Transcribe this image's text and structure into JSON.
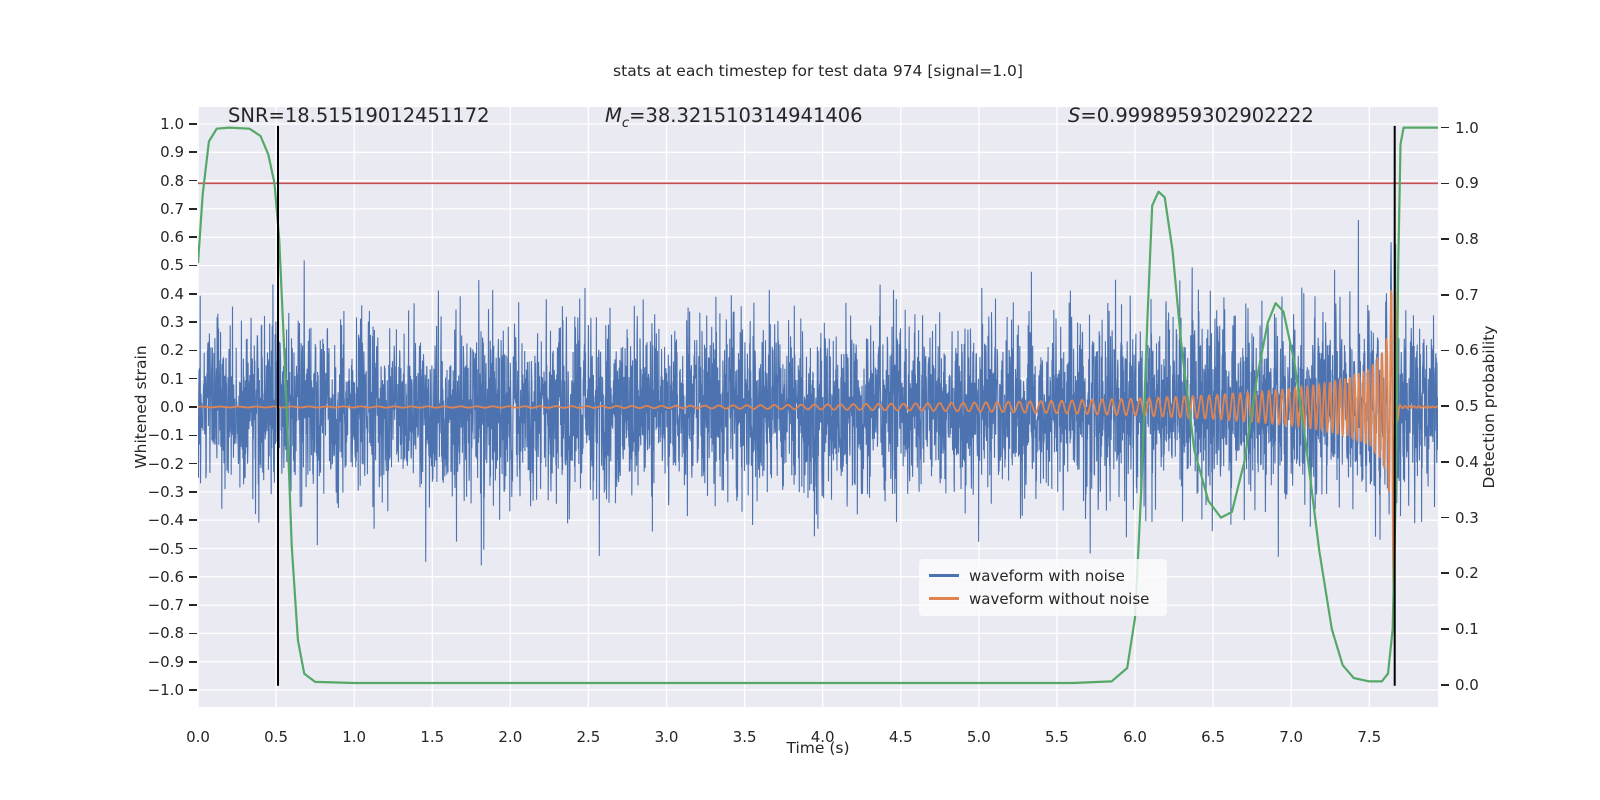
{
  "title": "stats at each timestep for test data 974 [signal=1.0]",
  "annotations": {
    "snr": "SNR=18.51519012451172",
    "mc_symbol": "M",
    "mc_sub": "c",
    "mc_value": "=38.321510314941406",
    "s_symbol": "S",
    "s_value": "=0.9998959302902222"
  },
  "axis_labels": {
    "y_left": "Whitened strain",
    "y_right": "Detection probability",
    "x": "Time (s)"
  },
  "legend": {
    "position": "lower right",
    "items": [
      {
        "label": "waveform with noise",
        "color": "#4C72B0"
      },
      {
        "label": "waveform without noise",
        "color": "#DD8452"
      }
    ]
  },
  "colors": {
    "axes_background": "#EAEAF2",
    "grid": "#FFFFFF",
    "text": "#262626",
    "noise_waveform": "#4C72B0",
    "clean_waveform": "#DD8452",
    "detection_probability": "#55A868",
    "threshold_line": "#C44E52",
    "marker_line": "#000000"
  },
  "chart_data": {
    "type": "line",
    "title": "stats at each timestep for test data 974 [signal=1.0]",
    "grid": true,
    "x_axis": {
      "label": "Time (s)",
      "range": [
        0,
        7.94
      ],
      "tick_labels": [
        "0.0",
        "0.5",
        "1.0",
        "1.5",
        "2.0",
        "2.5",
        "3.0",
        "3.5",
        "4.0",
        "4.5",
        "5.0",
        "5.5",
        "6.0",
        "6.5",
        "7.0",
        "7.5"
      ],
      "tick_values": [
        0,
        0.5,
        1,
        1.5,
        2,
        2.5,
        3,
        3.5,
        4,
        4.5,
        5,
        5.5,
        6,
        6.5,
        7,
        7.5
      ]
    },
    "y_left_axis": {
      "label": "Whitened strain",
      "range": [
        -1.06,
        1.06
      ],
      "tick_labels": [
        "1.0",
        "0.9",
        "0.8",
        "0.7",
        "0.6",
        "0.5",
        "0.4",
        "0.3",
        "0.2",
        "0.1",
        "0.0",
        "−0.1",
        "−0.2",
        "−0.3",
        "−0.4",
        "−0.5",
        "−0.6",
        "−0.7",
        "−0.8",
        "−0.9",
        "−1.0"
      ],
      "tick_values": [
        1,
        0.9,
        0.8,
        0.7,
        0.6,
        0.5,
        0.4,
        0.3,
        0.2,
        0.1,
        0,
        -0.1,
        -0.2,
        -0.3,
        -0.4,
        -0.5,
        -0.6,
        -0.7,
        -0.8,
        -0.9,
        -1
      ]
    },
    "y_right_axis": {
      "label": "Detection probability",
      "range": [
        -0.04,
        1.037
      ],
      "tick_labels": [
        "0.0",
        "0.1",
        "0.2",
        "0.3",
        "0.4",
        "0.5",
        "0.6",
        "0.7",
        "0.8",
        "0.9",
        "1.0"
      ],
      "tick_values": [
        0,
        0.1,
        0.2,
        0.3,
        0.4,
        0.5,
        0.6,
        0.7,
        0.8,
        0.9,
        1
      ]
    },
    "series": [
      {
        "name": "waveform with noise",
        "color": "#4C72B0",
        "axis": "left",
        "style": "gaussian_noise_plus_signal",
        "noise_sigma": 0.155,
        "n_points": 5000,
        "seed": 974,
        "line_width": 1.1
      },
      {
        "name": "waveform without noise",
        "color": "#DD8452",
        "axis": "left",
        "style": "chirp",
        "n_points": 6000,
        "line_width": 1.8,
        "merger_time": 7.663,
        "envelope": [
          [
            0,
            0.0015
          ],
          [
            2,
            0.0025
          ],
          [
            3,
            0.004
          ],
          [
            3.5,
            0.006
          ],
          [
            4,
            0.009
          ],
          [
            4.5,
            0.012
          ],
          [
            5,
            0.016
          ],
          [
            5.5,
            0.022
          ],
          [
            6,
            0.03
          ],
          [
            6.5,
            0.042
          ],
          [
            6.8,
            0.055
          ],
          [
            7,
            0.065
          ],
          [
            7.2,
            0.082
          ],
          [
            7.35,
            0.1
          ],
          [
            7.5,
            0.135
          ],
          [
            7.58,
            0.19
          ],
          [
            7.62,
            0.26
          ],
          [
            7.645,
            0.45
          ],
          [
            7.658,
            0.75
          ],
          [
            7.663,
            0.85
          ],
          [
            7.667,
            0.45
          ],
          [
            7.672,
            0.18
          ],
          [
            7.68,
            0.06
          ],
          [
            7.69,
            0.015
          ],
          [
            7.7,
            0.004
          ],
          [
            7.94,
            0.002
          ]
        ],
        "freq_model": {
          "f_ref": 18,
          "t_ref": 7.75,
          "tau_ref": 1.5,
          "exponent": -0.45,
          "t_freeze": 7.66,
          "f_cap": 34
        }
      },
      {
        "name": "detection probability",
        "color": "#55A868",
        "axis": "right",
        "line_width": 2.2,
        "points": [
          [
            0,
            0.757
          ],
          [
            0.03,
            0.88
          ],
          [
            0.07,
            0.975
          ],
          [
            0.12,
            0.998
          ],
          [
            0.2,
            1.0
          ],
          [
            0.33,
            0.998
          ],
          [
            0.4,
            0.985
          ],
          [
            0.45,
            0.952
          ],
          [
            0.49,
            0.9
          ],
          [
            0.52,
            0.8
          ],
          [
            0.56,
            0.55
          ],
          [
            0.6,
            0.25
          ],
          [
            0.64,
            0.08
          ],
          [
            0.68,
            0.02
          ],
          [
            0.75,
            0.005
          ],
          [
            1.0,
            0.003
          ],
          [
            2.0,
            0.003
          ],
          [
            3.0,
            0.003
          ],
          [
            4.0,
            0.003
          ],
          [
            5.0,
            0.003
          ],
          [
            5.6,
            0.003
          ],
          [
            5.85,
            0.006
          ],
          [
            5.95,
            0.03
          ],
          [
            6.0,
            0.12
          ],
          [
            6.04,
            0.35
          ],
          [
            6.08,
            0.66
          ],
          [
            6.11,
            0.86
          ],
          [
            6.15,
            0.885
          ],
          [
            6.19,
            0.875
          ],
          [
            6.24,
            0.78
          ],
          [
            6.3,
            0.6
          ],
          [
            6.38,
            0.42
          ],
          [
            6.47,
            0.33
          ],
          [
            6.55,
            0.3
          ],
          [
            6.62,
            0.31
          ],
          [
            6.7,
            0.4
          ],
          [
            6.78,
            0.55
          ],
          [
            6.85,
            0.65
          ],
          [
            6.9,
            0.685
          ],
          [
            6.95,
            0.67
          ],
          [
            7.02,
            0.58
          ],
          [
            7.1,
            0.42
          ],
          [
            7.18,
            0.24
          ],
          [
            7.26,
            0.1
          ],
          [
            7.33,
            0.035
          ],
          [
            7.4,
            0.012
          ],
          [
            7.5,
            0.006
          ],
          [
            7.58,
            0.006
          ],
          [
            7.62,
            0.02
          ],
          [
            7.65,
            0.1
          ],
          [
            7.67,
            0.35
          ],
          [
            7.685,
            0.75
          ],
          [
            7.7,
            0.97
          ],
          [
            7.72,
            1.0
          ],
          [
            7.94,
            1.0
          ]
        ]
      }
    ],
    "reference_lines": {
      "h_line": {
        "value": 0.9,
        "axis": "right",
        "color": "#C44E52",
        "line_width": 1.6
      },
      "v_lines": [
        {
          "t": 0.512,
          "color": "#000000",
          "line_width": 2
        },
        {
          "t": 7.663,
          "color": "#000000",
          "line_width": 2
        }
      ]
    }
  }
}
